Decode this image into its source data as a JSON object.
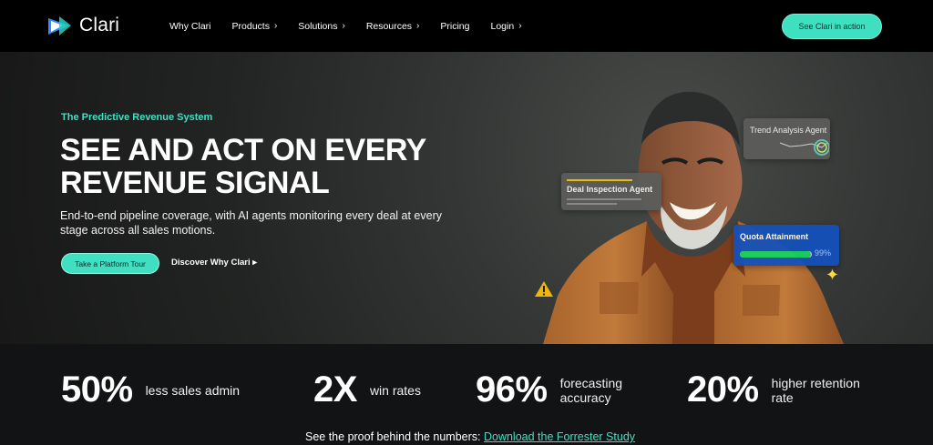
{
  "brand": {
    "name": "Clari",
    "accent": "#3fe0c1",
    "background": "#000000"
  },
  "nav": {
    "items": [
      {
        "label": "Why Clari",
        "chevron": false
      },
      {
        "label": "Products",
        "chevron": true
      },
      {
        "label": "Solutions",
        "chevron": true
      },
      {
        "label": "Resources",
        "chevron": true
      },
      {
        "label": "Pricing",
        "chevron": false
      },
      {
        "label": "Login",
        "chevron": true
      }
    ],
    "cta": "See Clari in action"
  },
  "hero": {
    "eyebrow": "The Predictive Revenue System",
    "headline": "SEE AND ACT ON EVERY REVENUE SIGNAL",
    "subtext": "End-to-end pipeline coverage, with AI agents monitoring every deal at every stage across all sales motions.",
    "primary_button": "Take a Platform Tour",
    "secondary_button": "Discover Why Clari ▸"
  },
  "cards": {
    "trend": "Trend Analysis Agent",
    "deal": "Deal Inspection Agent",
    "quota": "Quota Attainment",
    "quota_value": "99%",
    "quota_fill": 0.99
  },
  "stats": [
    {
      "number": "50%",
      "label": "less sales admin"
    },
    {
      "number": "2X",
      "label": "win rates"
    },
    {
      "number": "96%",
      "label": "forecasting accuracy"
    },
    {
      "number": "20%",
      "label": "higher retention rate"
    }
  ],
  "proof": {
    "text": "See the proof behind the numbers: ",
    "link": "Download the Forrester Study"
  },
  "icons": [
    "clari-logo-icon",
    "chevron-right-icon",
    "warning-icon",
    "sparkle-icon",
    "trend-chart-icon"
  ]
}
